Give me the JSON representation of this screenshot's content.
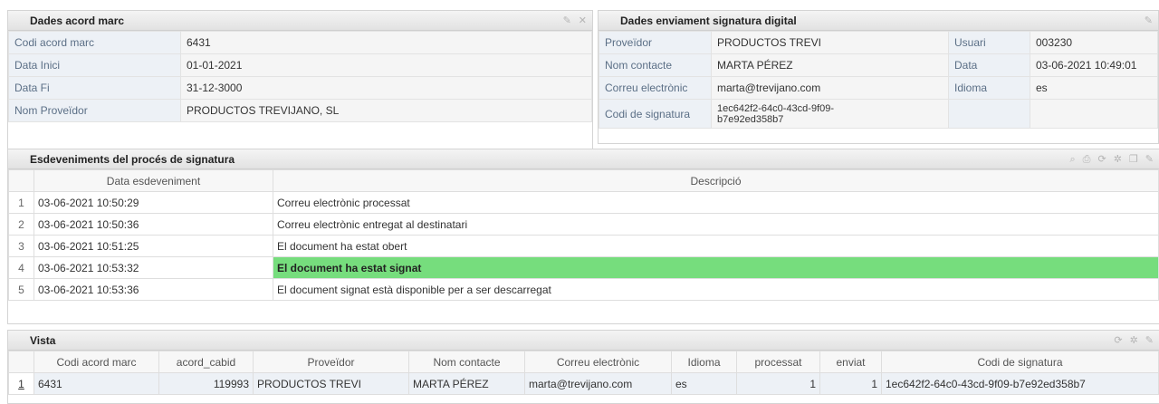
{
  "acord": {
    "title": "Dades acord marc",
    "rows": [
      {
        "label": "Codi acord marc",
        "value": "6431"
      },
      {
        "label": "Data Inici",
        "value": "01-01-2021"
      },
      {
        "label": "Data Fi",
        "value": "31-12-3000"
      },
      {
        "label": "Nom Proveïdor",
        "value": "PRODUCTOS TREVIJANO, SL"
      }
    ]
  },
  "enviament": {
    "title": "Dades enviament signatura digital",
    "rows": [
      {
        "label": "Proveïdor",
        "value": "PRODUCTOS TREVI",
        "label2": "Usuari",
        "value2": "003230"
      },
      {
        "label": "Nom contacte",
        "value": "MARTA PÉREZ",
        "label2": "Data",
        "value2": "03-06-2021 10:49:01"
      },
      {
        "label": "Correu electrònic",
        "value": "marta@trevijano.com",
        "label2": "Idioma",
        "value2": "es"
      },
      {
        "label": "Codi de signatura",
        "value": "1ec642f2-64c0-43cd-9f09-b7e92ed358b7",
        "label2": "",
        "value2": ""
      }
    ]
  },
  "esdeveniments": {
    "title": "Esdeveniments del procés de signatura",
    "columns": [
      "Data esdeveniment",
      "Descripció"
    ],
    "rows": [
      {
        "n": "1",
        "data": "03-06-2021 10:50:29",
        "desc": "Correu electrònic processat",
        "hl": false
      },
      {
        "n": "2",
        "data": "03-06-2021 10:50:36",
        "desc": "Correu electrònic entregat al destinatari",
        "hl": false
      },
      {
        "n": "3",
        "data": "03-06-2021 10:51:25",
        "desc": "El document ha estat obert",
        "hl": false
      },
      {
        "n": "4",
        "data": "03-06-2021 10:53:32",
        "desc": "El document ha estat signat",
        "hl": true
      },
      {
        "n": "5",
        "data": "03-06-2021 10:53:36",
        "desc": "El document signat està disponible per a ser descarregat",
        "hl": false
      }
    ]
  },
  "vista": {
    "title": "Vista",
    "columns": [
      "Codi acord marc",
      "acord_cabid",
      "Proveïdor",
      "Nom contacte",
      "Correu electrònic",
      "Idioma",
      "processat",
      "enviat",
      "Codi de signatura"
    ],
    "row": {
      "n": "1",
      "cells": [
        "6431",
        "119993",
        "PRODUCTOS TREVI",
        "MARTA PÉREZ",
        "marta@trevijano.com",
        "es",
        "1",
        "1",
        "1ec642f2-64c0-43cd-9f09-b7e92ed358b7"
      ]
    }
  },
  "colors": {
    "highlight": "#76dd7d",
    "label_bg": "#edf1f6"
  }
}
